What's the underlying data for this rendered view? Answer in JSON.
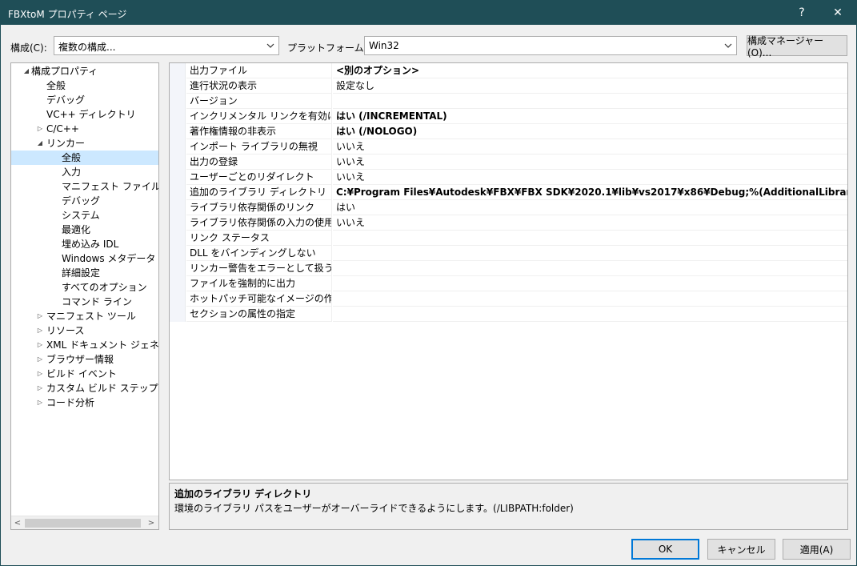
{
  "window": {
    "title": "FBXtoM プロパティ ページ",
    "help_glyph": "?",
    "close_glyph": "✕",
    "colors": {
      "titlebar": "#1f4e57",
      "selection": "#cce8ff",
      "accent": "#0078d7"
    }
  },
  "toolbar": {
    "config_label": "構成(C):",
    "config_value": "複数の構成...",
    "platform_label": "プラットフォーム(P):",
    "platform_value": "Win32",
    "config_manager_button": "構成マネージャー(O)..."
  },
  "tree": {
    "items": [
      {
        "label": "構成プロパティ",
        "expander": "◢",
        "level": 0
      },
      {
        "label": "全般",
        "expander": "",
        "level": 1
      },
      {
        "label": "デバッグ",
        "expander": "",
        "level": 1
      },
      {
        "label": "VC++ ディレクトリ",
        "expander": "",
        "level": 1
      },
      {
        "label": "C/C++",
        "expander": "▷",
        "level": 1
      },
      {
        "label": "リンカー",
        "expander": "◢",
        "level": 1
      },
      {
        "label": "全般",
        "expander": "",
        "level": 2,
        "selected": true
      },
      {
        "label": "入力",
        "expander": "",
        "level": 2
      },
      {
        "label": "マニフェスト ファイル",
        "expander": "",
        "level": 2
      },
      {
        "label": "デバッグ",
        "expander": "",
        "level": 2
      },
      {
        "label": "システム",
        "expander": "",
        "level": 2
      },
      {
        "label": "最適化",
        "expander": "",
        "level": 2
      },
      {
        "label": "埋め込み IDL",
        "expander": "",
        "level": 2
      },
      {
        "label": "Windows メタデータ",
        "expander": "",
        "level": 2
      },
      {
        "label": "詳細設定",
        "expander": "",
        "level": 2
      },
      {
        "label": "すべてのオプション",
        "expander": "",
        "level": 2
      },
      {
        "label": "コマンド ライン",
        "expander": "",
        "level": 2
      },
      {
        "label": "マニフェスト ツール",
        "expander": "▷",
        "level": 1
      },
      {
        "label": "リソース",
        "expander": "▷",
        "level": 1
      },
      {
        "label": "XML ドキュメント ジェネレーター",
        "expander": "▷",
        "level": 1
      },
      {
        "label": "ブラウザー情報",
        "expander": "▷",
        "level": 1
      },
      {
        "label": "ビルド イベント",
        "expander": "▷",
        "level": 1
      },
      {
        "label": "カスタム ビルド ステップ",
        "expander": "▷",
        "level": 1
      },
      {
        "label": "コード分析",
        "expander": "▷",
        "level": 1
      }
    ],
    "scroll_left": "<",
    "scroll_right": ">"
  },
  "grid": {
    "rows": [
      {
        "name": "出力ファイル",
        "value": "<別のオプション>",
        "bold": true
      },
      {
        "name": "進行状況の表示",
        "value": "設定なし",
        "bold": false
      },
      {
        "name": "バージョン",
        "value": "",
        "bold": false
      },
      {
        "name": "インクリメンタル リンクを有効にする",
        "value": "はい (/INCREMENTAL)",
        "bold": true
      },
      {
        "name": "著作権情報の非表示",
        "value": "はい (/NOLOGO)",
        "bold": true
      },
      {
        "name": "インポート ライブラリの無視",
        "value": "いいえ",
        "bold": false
      },
      {
        "name": "出力の登録",
        "value": "いいえ",
        "bold": false
      },
      {
        "name": "ユーザーごとのリダイレクト",
        "value": "いいえ",
        "bold": false
      },
      {
        "name": "追加のライブラリ ディレクトリ",
        "value": "C:¥Program Files¥Autodesk¥FBX¥FBX SDK¥2020.1¥lib¥vs2017¥x86¥Debug;%(AdditionalLibraryDirectories)",
        "bold": true,
        "selected": true
      },
      {
        "name": "ライブラリ依存関係のリンク",
        "value": "はい",
        "bold": false
      },
      {
        "name": "ライブラリ依存関係の入力の使用",
        "value": "いいえ",
        "bold": false
      },
      {
        "name": "リンク ステータス",
        "value": "",
        "bold": false
      },
      {
        "name": "DLL をバインディングしない",
        "value": "",
        "bold": false
      },
      {
        "name": "リンカー警告をエラーとして扱う",
        "value": "",
        "bold": false
      },
      {
        "name": "ファイルを強制的に出力",
        "value": "",
        "bold": false
      },
      {
        "name": "ホットパッチ可能なイメージの作成",
        "value": "",
        "bold": false
      },
      {
        "name": "セクションの属性の指定",
        "value": "",
        "bold": false
      }
    ]
  },
  "description": {
    "title": "追加のライブラリ ディレクトリ",
    "text": "環境のライブラリ パスをユーザーがオーバーライドできるようにします。(/LIBPATH:folder)"
  },
  "buttons": {
    "ok": "OK",
    "cancel": "キャンセル",
    "apply": "適用(A)"
  }
}
